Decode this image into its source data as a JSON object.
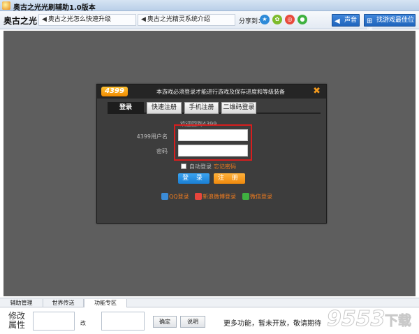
{
  "window": {
    "title": "奥古之光光刷辅助1.0版本"
  },
  "toolbar": {
    "game_name": "奥古之光",
    "links": [
      {
        "label": "奥古之光怎么快速升级"
      },
      {
        "label": "奥古之光精灵系统介绍"
      }
    ],
    "share_label": "分享到：",
    "share_icons": [
      "qzone-icon",
      "friend-icon",
      "weibo-icon",
      "wechat-icon"
    ],
    "sound_label": "声音",
    "best_position_label": "找游戏最佳位置"
  },
  "login_dialog": {
    "logo": "4399",
    "notice": "本游戏必须登录才能进行游戏及保存进度和等级装备",
    "tabs": [
      "登录",
      "快速注册",
      "手机注册",
      "二维码登录"
    ],
    "active_tab": 0,
    "welcome": "欢迎回到4399",
    "username_label": "4399用户名",
    "password_label": "密码",
    "username_value": "",
    "password_value": "",
    "auto_login_label": "自动登录",
    "forget_password_label": "忘记密码",
    "login_button": "登 录",
    "register_button": "注 册",
    "social_logins": [
      {
        "label": "QQ登录",
        "icon": "qq-icon"
      },
      {
        "label": "新浪微博登录",
        "icon": "weibo-icon"
      },
      {
        "label": "微信登录",
        "icon": "wechat-icon"
      }
    ],
    "highlight_color": "#d81e1e"
  },
  "bottom_tabs": [
    "辅助管理",
    "世界传送",
    "功能专区"
  ],
  "active_bottom_tab": 2,
  "bottom_panel": {
    "modify_label": "修改属性",
    "change_label": "改",
    "confirm_button": "确定",
    "explain_button": "说明",
    "more_text": "更多功能，暂未开放，敬请期待"
  },
  "watermark": {
    "text": "9553",
    "subtext": "下载"
  }
}
